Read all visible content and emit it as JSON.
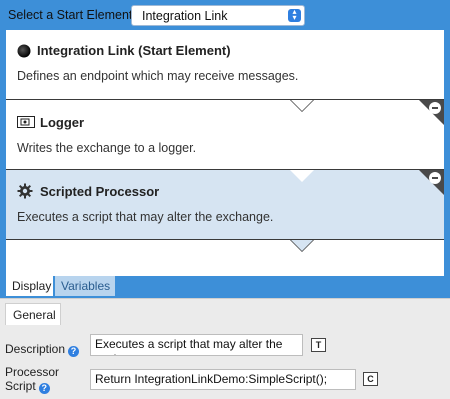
{
  "header": {
    "start_label": "Select a Start Element:",
    "start_value": "Integration Link"
  },
  "nodes": [
    {
      "title": "Integration Link (Start Element)",
      "description": "Defines an endpoint which may receive messages.",
      "icon": "filled-circle-icon"
    },
    {
      "title": "Logger",
      "description": "Writes the exchange to a logger.",
      "icon": "logger-icon"
    },
    {
      "title": "Scripted Processor",
      "description": "Executes a script that may alter the exchange.",
      "icon": "gear-icon",
      "selected": true,
      "highlight_color": "#d6e4f2"
    }
  ],
  "canvas_tabs": {
    "display": "Display",
    "variables": "Variables"
  },
  "properties": {
    "tab_label": "General",
    "description_label": "Description",
    "description_value": "Executes a script that may alter the exchange.",
    "script_label_line1": "Processor",
    "script_label_line2": "Script",
    "script_value": "Return IntegrationLinkDemo:SimpleScript();",
    "text_button_glyph": "T",
    "code_button_glyph": "C",
    "help_glyph": "?"
  },
  "colors": {
    "frame": "#3d8fd8",
    "accent": "#2f7fe0",
    "separator": "#3a3a3a"
  }
}
